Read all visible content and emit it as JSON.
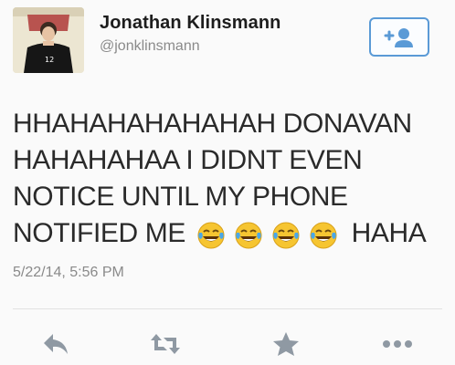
{
  "user": {
    "name": "Jonathan Klinsmann",
    "handle": "@jonklinsmann",
    "jersey_number": "12"
  },
  "follow_button": {
    "icon": "add-user-icon",
    "color": "#5a9ad6"
  },
  "tweet": {
    "lines": [
      "HHAHAHAHAHAHAH DONAVAN",
      "HAHAHAHAA I DIDNT EVEN",
      "NOTICE UNTIL MY PHONE",
      "NOTIFIED ME"
    ],
    "trailing_text": "HAHA",
    "emojis": [
      "face-with-tears-of-joy",
      "face-with-tears-of-joy",
      "face-with-tears-of-joy",
      "face-with-tears-of-joy"
    ],
    "timestamp": "5/22/14, 5:56 PM"
  },
  "actions": [
    {
      "name": "reply",
      "icon": "reply-icon"
    },
    {
      "name": "retweet",
      "icon": "retweet-icon"
    },
    {
      "name": "favorite",
      "icon": "star-icon"
    },
    {
      "name": "more",
      "icon": "more-icon"
    }
  ],
  "colors": {
    "text": "#2a2a2a",
    "secondary_text": "#8a8a8a",
    "action_icons": "#8f99a3",
    "emoji_face": "#f6c531",
    "emoji_tears": "#4aa7e8"
  }
}
